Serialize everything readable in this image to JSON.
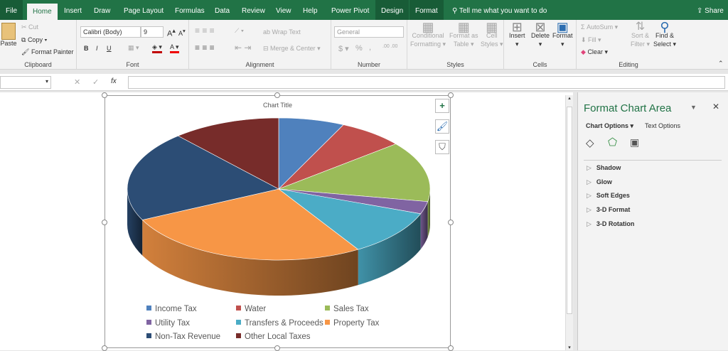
{
  "tabs": [
    "File",
    "Home",
    "Insert",
    "Draw",
    "Page Layout",
    "Formulas",
    "Data",
    "Review",
    "View",
    "Help",
    "Power Pivot",
    "Design",
    "Format"
  ],
  "tell_me": "Tell me what you want to do",
  "share": "Share",
  "clipboard": {
    "paste": "Paste",
    "cut": "Cut",
    "copy": "Copy",
    "format_painter": "Format Painter",
    "label": "Clipboard"
  },
  "font": {
    "name": "Calibri (Body)",
    "size": "9",
    "bold": "B",
    "italic": "I",
    "underline": "U",
    "label": "Font"
  },
  "alignment": {
    "wrap": "Wrap Text",
    "merge": "Merge & Center",
    "label": "Alignment"
  },
  "number": {
    "format": "General",
    "currency": "$",
    "percent": "%",
    "comma": ",",
    "label": "Number"
  },
  "styles": {
    "conditional": "Conditional",
    "conditional2": "Formatting",
    "table": "Format as",
    "table2": "Table",
    "cell": "Cell",
    "cell2": "Styles",
    "label": "Styles"
  },
  "cells": {
    "insert": "Insert",
    "delete": "Delete",
    "format": "Format",
    "label": "Cells"
  },
  "editing": {
    "autosum": "AutoSum",
    "fill": "Fill",
    "clear": "Clear",
    "sort": "Sort &",
    "sort2": "Filter",
    "find": "Find &",
    "find2": "Select",
    "label": "Editing"
  },
  "formula_bar": {
    "fx": "fx",
    "value": ""
  },
  "pane": {
    "title": "Format Chart Area",
    "chart_options": "Chart Options",
    "text_options": "Text Options",
    "sections": [
      "Shadow",
      "Glow",
      "Soft Edges",
      "3-D Format",
      "3-D Rotation"
    ]
  },
  "colors": {
    "accent": "#217346"
  },
  "chart_data": {
    "type": "pie",
    "three_d": true,
    "title": "Chart Title",
    "legend_position": "bottom",
    "categories": [
      "Income Tax",
      "Water",
      "Sales Tax",
      "Utility Tax",
      "Transfers & Proceeds",
      "Property Tax",
      "Non-Tax Revenue",
      "Other Local Taxes"
    ],
    "values": [
      7,
      7,
      13.7,
      2.8,
      10.5,
      26.5,
      20.5,
      11.5
    ],
    "colors": [
      "#4f81bd",
      "#c0504d",
      "#9bbb59",
      "#8064a2",
      "#4bacc6",
      "#f79646",
      "#2c4d75",
      "#772c2a"
    ]
  }
}
